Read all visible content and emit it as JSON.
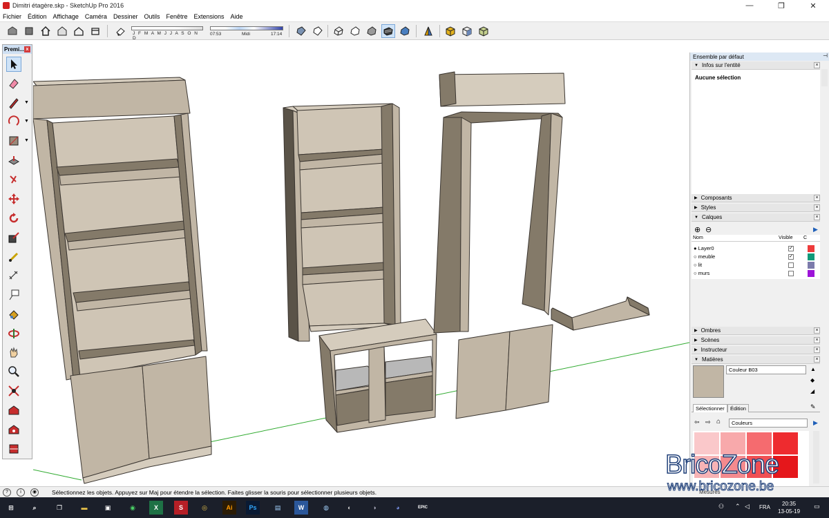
{
  "window": {
    "title": "Dimitri étagère.skp - SketchUp Pro 2016",
    "min": "—",
    "max": "❐",
    "close": "✕"
  },
  "menu": [
    "Fichier",
    "Édition",
    "Affichage",
    "Caméra",
    "Dessiner",
    "Outils",
    "Fenêtre",
    "Extensions",
    "Aide"
  ],
  "toolbar": {
    "months": "J F M A M J J A S O N D",
    "time_start": "07:53",
    "time_mid": "Midi",
    "time_end": "17:14"
  },
  "palette": {
    "title": "Premi...",
    "close": "x"
  },
  "tray": {
    "title": "Ensemble par défaut",
    "pin": "⊣",
    "entity_info": "Infos sur l'entité",
    "no_selection": "Aucune sélection",
    "components": "Composants",
    "styles": "Styles",
    "layers": "Calques",
    "layers_cols": {
      "name": "Nom",
      "visible": "Visible",
      "color": "C"
    },
    "layers_rows": [
      {
        "name": "Layer0",
        "visible": "✓",
        "color": "#ee3b3b",
        "active": true
      },
      {
        "name": "meuble",
        "visible": "✓",
        "color": "#119a7a",
        "active": false
      },
      {
        "name": "lit",
        "visible": "",
        "color": "#7c7bab",
        "active": false
      },
      {
        "name": "murs",
        "visible": "",
        "color": "#9d14d8",
        "active": false
      }
    ],
    "shadows": "Ombres",
    "scenes": "Scènes",
    "instructor": "Instructeur",
    "materials": "Matières",
    "material_name": "Couleur B03",
    "tab_select": "Sélectionner",
    "tab_edit": "Édition",
    "library": "Couleurs",
    "swatches": [
      "#fac8ca",
      "#f8a9ab",
      "#f56b6f",
      "#ee2b2f",
      "#f7b3b5",
      "#f48a8e",
      "#f04f53",
      "#e5171b"
    ]
  },
  "status": {
    "text": "Sélectionnez les objets. Appuyez sur Maj pour étendre la sélection. Faites glisser la souris pour sélectionner plusieurs objets.",
    "measures": "Mesures"
  },
  "taskbar": {
    "lang": "FRA",
    "time": "20:35",
    "date": "13-05-19"
  },
  "watermark": {
    "title": "BricoZone",
    "url": "www.bricozone.be"
  },
  "colors": {
    "wood": "#c1b6a5",
    "wood_dark": "#847a69",
    "edge": "#3a3530",
    "green_axis": "#2faa2f"
  }
}
